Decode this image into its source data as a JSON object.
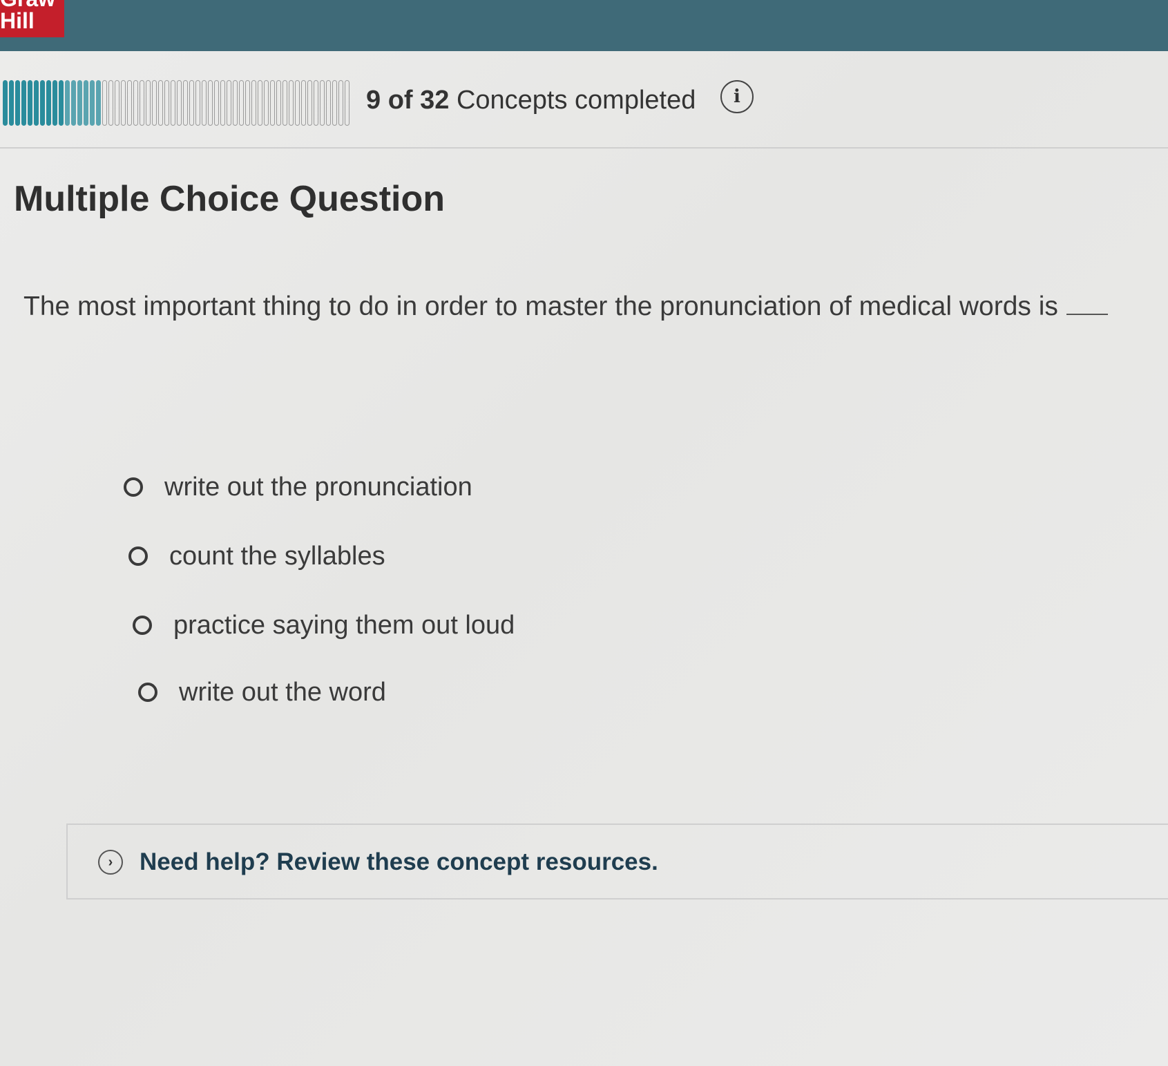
{
  "header": {
    "brand_top": "Graw",
    "brand_bottom": "Hill",
    "accent_color": "#3f6a78",
    "logo_color": "#c41f2b"
  },
  "progress": {
    "completed": 9,
    "total": 32,
    "bold_label": "9 of 32",
    "label": "Concepts completed",
    "info_icon": "info-icon",
    "info_glyph": "i"
  },
  "question": {
    "heading": "Multiple Choice Question",
    "prompt": "The most important thing to do in order to master the pronunciation of medical words is",
    "options": [
      {
        "label": "write out the pronunciation"
      },
      {
        "label": "count the syllables"
      },
      {
        "label": "practice saying them out loud"
      },
      {
        "label": "write out the word"
      }
    ]
  },
  "help": {
    "icon": "chevron-right-icon",
    "glyph": "›",
    "label": "Need help? Review these concept resources."
  }
}
